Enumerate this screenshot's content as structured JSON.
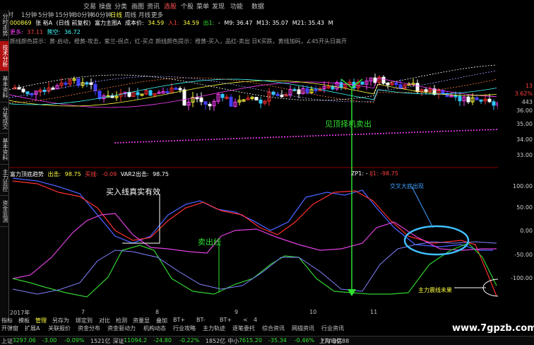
{
  "top_menu": [
    "分时",
    "1分钟",
    "5分钟",
    "15分钟",
    "30分钟",
    "60分钟",
    "日线",
    "周线",
    "月线",
    "更多"
  ],
  "nav_menu": [
    "交易",
    "操盘",
    "分类",
    "画图",
    "资讯",
    "选股",
    "个股",
    "菜单",
    "发现",
    "功能",
    "数据"
  ],
  "sidebar_tabs": [
    "分时走势",
    "技术分析",
    "基本资料",
    "分笔成交",
    "基本资料",
    "主力监控",
    "资金监测"
  ],
  "info_bar": {
    "code": "000869",
    "name": "张 裕A",
    "mode": "(日线 前复权)",
    "indicator": "富力主图A",
    "cost_label": "成本价:",
    "cost_value": "34.59",
    "buy1_label": "入1:",
    "buy1_value": "34.59",
    "out1_label": "出1:",
    "out1_value": "-",
    "m9": "M9: 36.47",
    "m13": "M13: 35.07",
    "m21": "M21: 35.43",
    "m_extra": "M",
    "more_label": "更多:",
    "more_value": "37.11",
    "bear_label": "熊空:",
    "bear_value": "36.72"
  },
  "note_bar": "颜线颜色提示：黄-启动，橙黄-攻击，紫兰-拐点，红-买点 颜线颜色提示：橙黄-买入，品红-卖出 日K买跌，黄线加码，∠45开头日高开",
  "price_axis": [
    "3.62%",
    "443",
    "36.00",
    "35.00",
    "34.00",
    "33.00"
  ],
  "top_right": [
    "13",
    "3"
  ],
  "indicator_header": {
    "name": "富力顶底趋势",
    "out_label": "出击:",
    "out_value": "98.75",
    "buy_label": "买线:",
    "buy_value": "-0.09",
    "var_label": "VAR2出击:",
    "var_value": "98.75",
    "zp_label": "ZP1:",
    "zp_value": "-",
    "ij_label": "IJ1:",
    "ij_value": "-98.75"
  },
  "indicator_axis": [
    "100.00",
    "50.00",
    "0.00",
    "-50.00",
    "-100.00"
  ],
  "annotations": {
    "buy_line": "买入线真实有效",
    "top_sell": "见顶择机卖出",
    "sell_line": "卖出线",
    "cross": "交叉大底出现",
    "main_wash": "主力震线未果"
  },
  "x_axis": [
    "2017年",
    "7",
    "8",
    "9",
    "10",
    "11"
  ],
  "toolbar1": [
    "指标",
    "模板",
    "管理",
    "另存为",
    "绑定到",
    "对比",
    "检测",
    "资量显",
    "叠加",
    "BT+",
    "BT-",
    "BT+",
    "<",
    "4"
  ],
  "toolbar2": [
    "开弹窗",
    "扩展A",
    "关联报价",
    "资金分布",
    "资金驱动力",
    "机构动态",
    "行业攻略",
    "主力轨迹",
    "逐笔委托",
    "综合资讯",
    "网描资讯",
    "行业资讯"
  ],
  "status_bar": [
    {
      "text": "上证",
      "color": "#c8c8c8"
    },
    {
      "text": "3297.06",
      "color": "#30e030"
    },
    {
      "text": "-3.00",
      "color": "#30e030"
    },
    {
      "text": "-0.09%",
      "color": "#30e030"
    },
    {
      "text": "1521亿",
      "color": "#c8c8c8"
    },
    {
      "text": "深证",
      "color": "#c8c8c8"
    },
    {
      "text": "11094.2",
      "color": "#30e030"
    },
    {
      "text": "-24.80",
      "color": "#30e030"
    },
    {
      "text": "-0.22%",
      "color": "#30e030"
    },
    {
      "text": "1852亿",
      "color": "#c8c8c8"
    },
    {
      "text": "中小",
      "color": "#c8c8c8"
    },
    {
      "text": "7615.20",
      "color": "#30e030"
    },
    {
      "text": "-35.34",
      "color": "#30e030"
    },
    {
      "text": "-0.46%",
      "color": "#30e030"
    },
    {
      "text": "777.3亿",
      "color": "#c8c8c8"
    },
    {
      "text": "上海电信88",
      "color": "#c8c8c8"
    }
  ],
  "watermark": "www.7gpzb.com",
  "colors": {
    "up": "#ff3030",
    "down": "#30c8ff",
    "accent": "#ffff40",
    "bg": "#000000"
  }
}
